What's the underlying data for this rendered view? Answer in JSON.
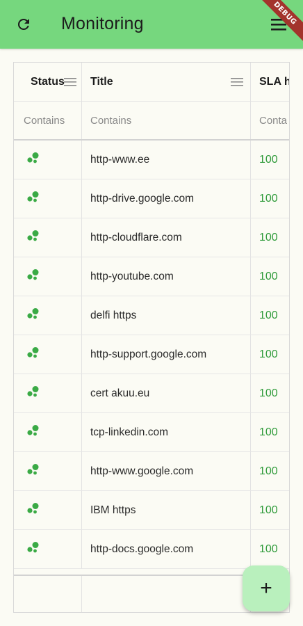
{
  "appbar": {
    "title": "Monitoring",
    "debug_label": "DEBUG",
    "refresh_icon": "refresh-icon",
    "menu_icon": "menu-icon",
    "color": "#76d77e"
  },
  "grid": {
    "columns": [
      {
        "label": "Status",
        "filter_placeholder": "Contains"
      },
      {
        "label": "Title",
        "filter_placeholder": "Contains"
      },
      {
        "label": "SLA h",
        "filter_placeholder": "Conta"
      }
    ],
    "rows": [
      {
        "status_icon": "status-online-icon",
        "title": "http-www.ee",
        "sla": "100"
      },
      {
        "status_icon": "status-online-icon",
        "title": "http-drive.google.com",
        "sla": "100"
      },
      {
        "status_icon": "status-online-icon",
        "title": "http-cloudflare.com",
        "sla": "100"
      },
      {
        "status_icon": "status-online-icon",
        "title": "http-youtube.com",
        "sla": "100"
      },
      {
        "status_icon": "status-online-icon",
        "title": "delfi https",
        "sla": "100"
      },
      {
        "status_icon": "status-online-icon",
        "title": "http-support.google.com",
        "sla": "100"
      },
      {
        "status_icon": "status-online-icon",
        "title": "cert akuu.eu",
        "sla": "100"
      },
      {
        "status_icon": "status-online-icon",
        "title": "tcp-linkedin.com",
        "sla": "100"
      },
      {
        "status_icon": "status-online-icon",
        "title": "http-www.google.com",
        "sla": "100"
      },
      {
        "status_icon": "status-online-icon",
        "title": "IBM https",
        "sla": "100"
      },
      {
        "status_icon": "status-online-icon",
        "title": "http-docs.google.com",
        "sla": "100"
      }
    ],
    "status_color": "#3aaa45",
    "sla_color": "#2f9b3a"
  },
  "fab": {
    "label": "+",
    "icon": "add-icon",
    "color": "#b9f0bd"
  }
}
